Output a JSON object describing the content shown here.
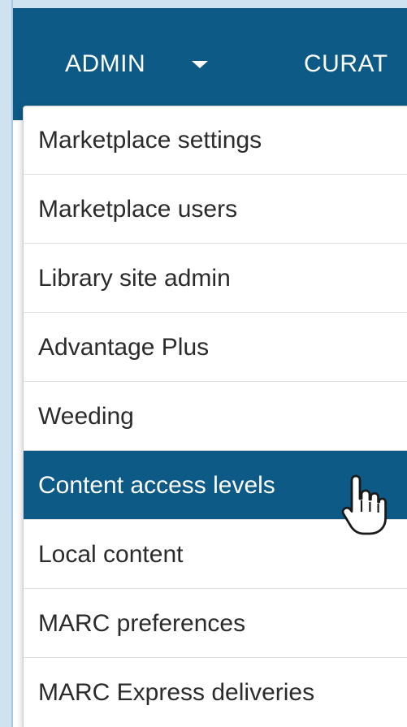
{
  "nav": {
    "admin_label": "ADMIN",
    "admin_caret_icon": "caret-down-icon",
    "curation_label": "CURAT"
  },
  "dropdown": {
    "items": [
      {
        "label": "Marketplace settings"
      },
      {
        "label": "Marketplace users"
      },
      {
        "label": "Library site admin"
      },
      {
        "label": "Advantage Plus"
      },
      {
        "label": "Weeding"
      },
      {
        "label": "Content access levels",
        "active": true
      },
      {
        "label": "Local content"
      },
      {
        "label": "MARC preferences"
      },
      {
        "label": "MARC Express deliveries"
      }
    ]
  },
  "cursor": {
    "icon": "hand-pointer-icon"
  },
  "colors": {
    "nav_background": "#0c5a85",
    "active_item_background": "#0c5a85",
    "frame": "#cfe2f0"
  }
}
